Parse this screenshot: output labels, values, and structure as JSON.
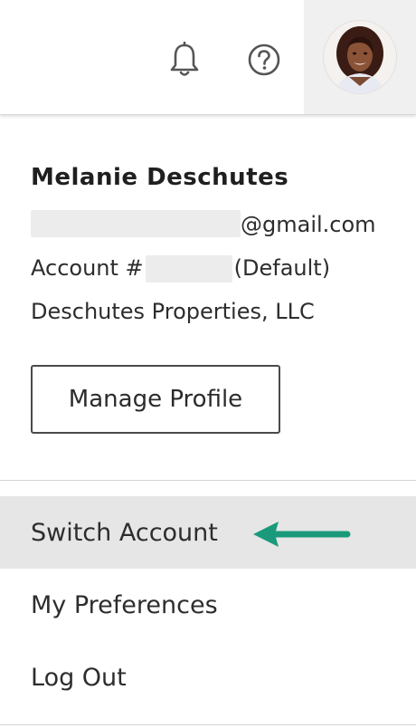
{
  "header": {
    "icons": [
      "bell-icon",
      "help-circle-icon"
    ],
    "avatar_alt": "User avatar"
  },
  "profile": {
    "name": "Melanie Deschutes",
    "email_suffix": "@gmail.com",
    "account_prefix": "Account #",
    "account_suffix": "(Default)",
    "company": "Deschutes Properties, LLC"
  },
  "actions": {
    "manage_profile": "Manage Profile"
  },
  "menu": {
    "items": [
      {
        "label": "Switch Account",
        "active": true
      },
      {
        "label": "My Preferences",
        "active": false
      },
      {
        "label": "Log Out",
        "active": false
      }
    ]
  },
  "colors": {
    "arrow": "#1a9a7a",
    "highlight": "#e6e6e6"
  }
}
